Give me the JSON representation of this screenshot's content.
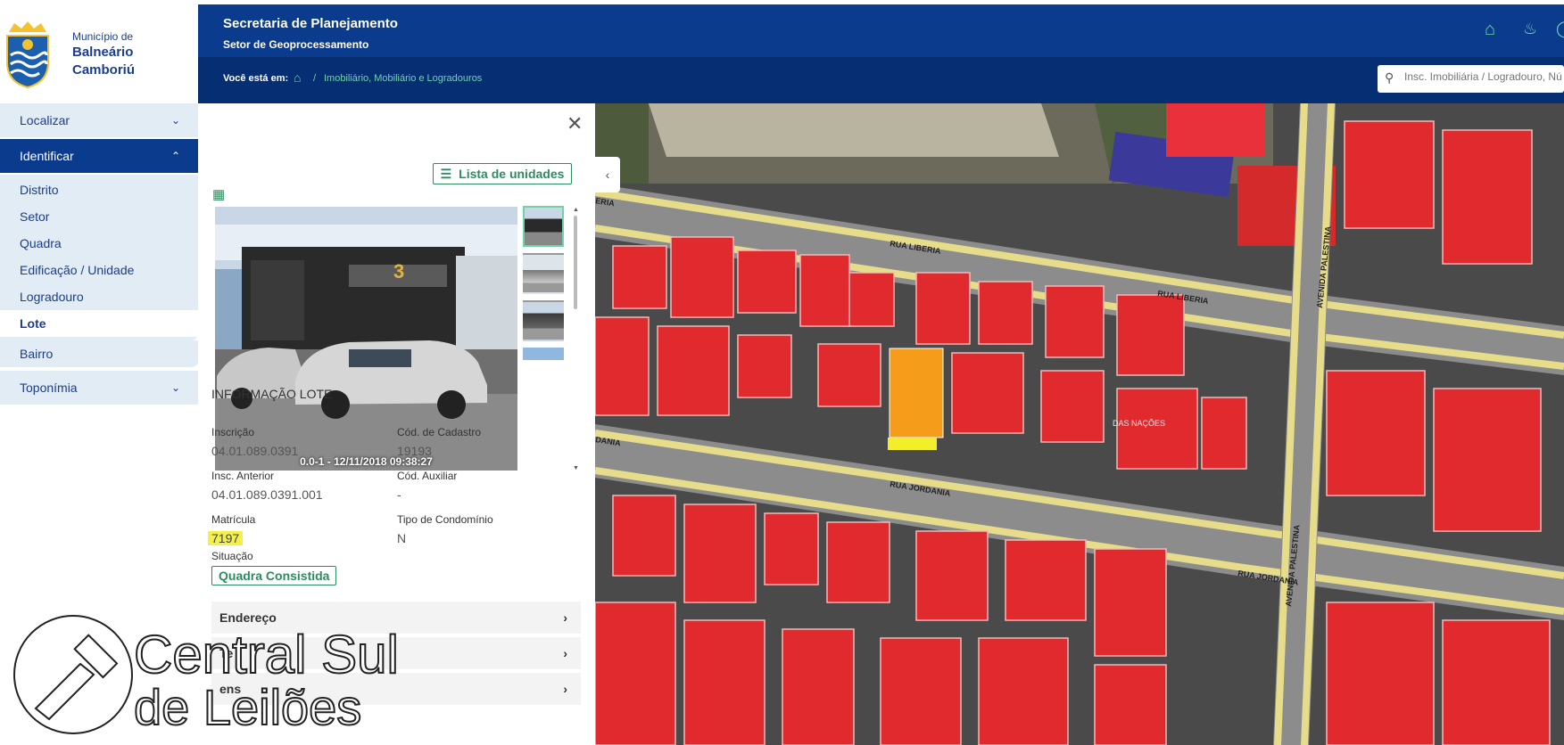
{
  "brand": {
    "line1": "Município de",
    "line2": "Balneário",
    "line3": "Camboriú",
    "logo": "coat-of-arms-icon"
  },
  "header": {
    "title": "Secretaria de Planejamento",
    "subtitle": "Setor de Geoprocessamento",
    "breadcrumb_label": "Você está em:",
    "breadcrumb_sep": "/",
    "breadcrumb_link": "Imobiliário, Mobiliário e Logradouros",
    "icons": [
      "home-icon",
      "bell-icon",
      "globe-icon"
    ]
  },
  "search": {
    "placeholder": "Insc. Imobiliária / Logradouro, Nú"
  },
  "nav": {
    "localizar": "Localizar",
    "identificar": "Identificar",
    "sub": [
      "Distrito",
      "Setor",
      "Quadra",
      "Edificação / Unidade",
      "Logradouro",
      "Lote"
    ],
    "bairro": "Bairro",
    "toponimia": "Toponímia"
  },
  "panel": {
    "list_button": "Lista de unidades",
    "photo_caption": "0.0-1 - 12/11/2018 09:38:27",
    "section_title": "INFORMAÇÃO LOTE",
    "fields": {
      "inscricao_label": "Inscrição",
      "inscricao_value": "04.01.089.0391",
      "cadastro_label": "Cód. de Cadastro",
      "cadastro_value": "19193",
      "anterior_label": "Insc. Anterior",
      "anterior_value": "04.01.089.0391.001",
      "auxiliar_label": "Cód. Auxiliar",
      "auxiliar_value": "-",
      "matricula_label": "Matrícula",
      "matricula_value": "7197",
      "condominio_label": "Tipo de Condomínio",
      "condominio_value": "N",
      "situacao_label": "Situação",
      "situacao_value": "Quadra Consistida"
    },
    "accordions": [
      "Endereço",
      "Te",
      "ens"
    ]
  },
  "map": {
    "streets": [
      "RUA LIBERIA",
      "RUA LIBERIA",
      "RUA JORDANIA",
      "RUA JORDANIA",
      "AVENIDA PALESTINA",
      "AVENIDA PALESTINA",
      "DAS NAÇÕES",
      "ERIA",
      "DANIA"
    ]
  },
  "watermark": {
    "line1": "Central Sul",
    "line2": "de Leilões"
  },
  "colors": {
    "header": "#0b3b8c",
    "accent": "#6fd3a8",
    "green": "#2e8b5f",
    "highlight": "#f4f04a"
  }
}
